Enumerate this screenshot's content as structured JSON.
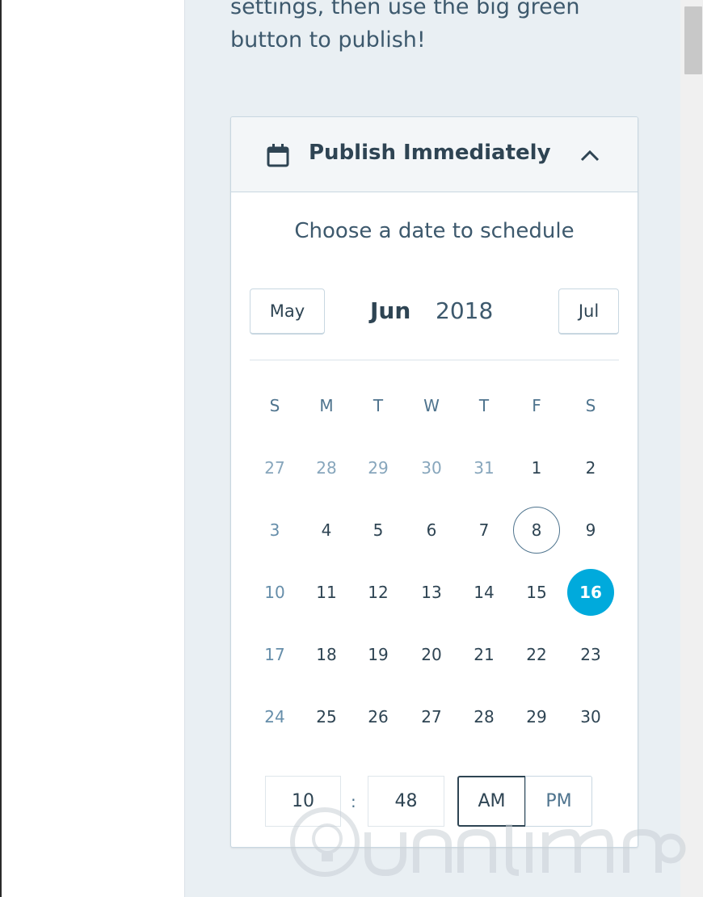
{
  "intro_text": "settings, then use the big green button to publish!",
  "publish": {
    "header_label": "Publish Immediately",
    "subtitle": "Choose a date to schedule",
    "prev_month": "May",
    "next_month": "Jul",
    "month": "Jun",
    "year": "2018"
  },
  "weekdays": [
    "S",
    "M",
    "T",
    "W",
    "T",
    "F",
    "S"
  ],
  "weeks": [
    [
      "27",
      "28",
      "29",
      "30",
      "31",
      "1",
      "2"
    ],
    [
      "3",
      "4",
      "5",
      "6",
      "7",
      "8",
      "9"
    ],
    [
      "10",
      "11",
      "12",
      "13",
      "14",
      "15",
      "16"
    ],
    [
      "17",
      "18",
      "19",
      "20",
      "21",
      "22",
      "23"
    ],
    [
      "24",
      "25",
      "26",
      "27",
      "28",
      "29",
      "30"
    ]
  ],
  "today_date": "8",
  "selected_date": "16",
  "time": {
    "hour": "10",
    "minute": "48",
    "separator": ":",
    "am_label": "AM",
    "pm_label": "PM",
    "period": "AM"
  },
  "colors": {
    "selected": "#00aadc",
    "sidebar_bg": "#e9eff3",
    "text": "#2e4453"
  }
}
